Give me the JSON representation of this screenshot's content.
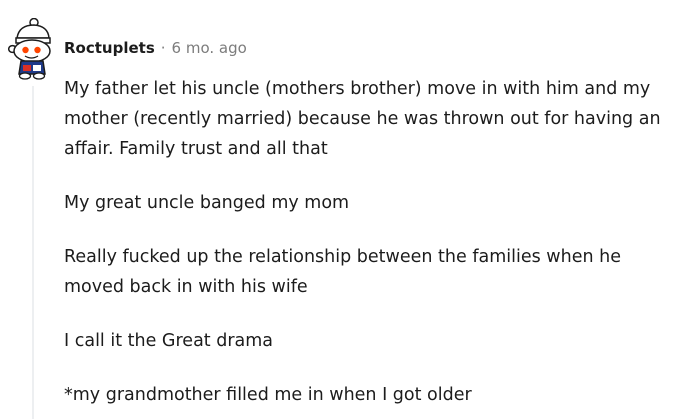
{
  "comment": {
    "avatar_icon": "snoo-avatar-icon",
    "username": "Roctuplets",
    "separator": "·",
    "timestamp": "6 mo. ago",
    "paragraphs": [
      "My father let his uncle (mothers brother) move in with him and my mother (recently married) because he was thrown out for having an affair. Family trust and all that",
      "My great uncle banged my mom",
      "Really fucked up the relationship between the families when he moved back in with his wife",
      "I call it the Great drama",
      "*my grandmother filled me in when I got older"
    ]
  },
  "colors": {
    "text": "#1c1c1c",
    "meta": "#7c7c7c",
    "thread_line": "#edeff1",
    "background": "#ffffff"
  }
}
